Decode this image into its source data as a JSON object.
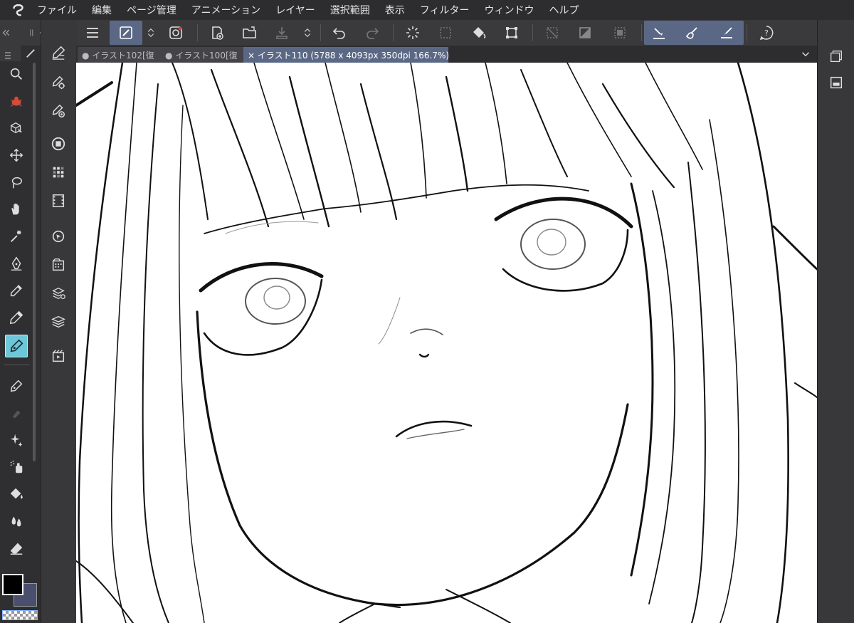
{
  "menu": {
    "items": [
      "ファイル",
      "編集",
      "ページ管理",
      "アニメーション",
      "レイヤー",
      "選択範囲",
      "表示",
      "フィルター",
      "ウィンドウ",
      "ヘルプ"
    ]
  },
  "tabs": [
    {
      "label": "● イラスト102[復"
    },
    {
      "label": "● イラスト100[復"
    },
    {
      "label": "× イラスト110 (5788 x 4093px 350dpi 166.7%)"
    }
  ],
  "colors": {
    "accent": "#5b6885",
    "selected_tool": "#6cc8d8",
    "main_color": "#000000",
    "sub_color": "#4a4f6e"
  },
  "left_tools": [
    "zoom-icon",
    "object-icon",
    "operation-icon",
    "move-icon",
    "lasso-icon",
    "hand-icon",
    "magic-wand-icon",
    "pen-icon",
    "eyedropper-icon",
    "pencil-icon",
    "vector-pen-icon",
    "marker-icon",
    "blend-icon",
    "sparkle-icon",
    "spray-icon",
    "fill-icon",
    "blur-icon",
    "eraser-icon"
  ],
  "sub_tools": [
    "brush-settings-icon",
    "sub-tool-detail-icon",
    "brush-size-icon",
    "color-circle-icon",
    "color-set-icon",
    "animation-icon",
    "navigator-icon",
    "material-icon",
    "layer-property-icon",
    "layer-icon",
    "timeline-icon"
  ]
}
